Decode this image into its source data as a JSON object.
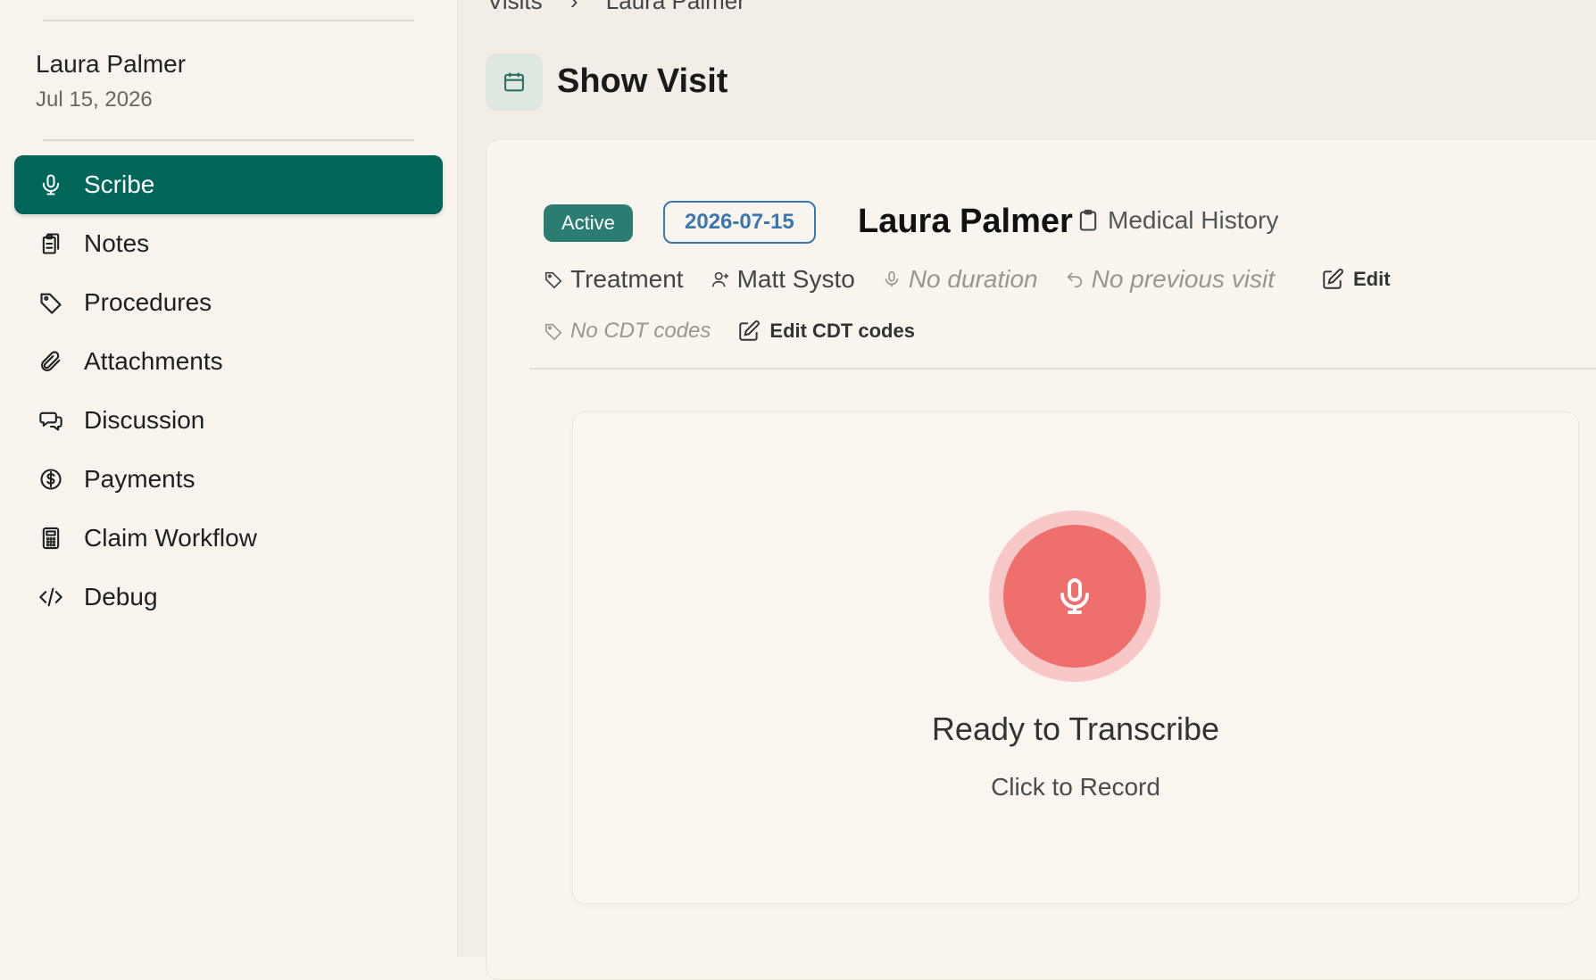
{
  "breadcrumb": {
    "root": "Visits",
    "sep": "›",
    "current": "Laura Palmer"
  },
  "sidebar": {
    "patient_name": "Laura Palmer",
    "patient_date": "Jul 15, 2026",
    "items": [
      {
        "label": "Scribe",
        "icon": "microphone-icon",
        "active": true
      },
      {
        "label": "Notes",
        "icon": "clipboard-copy-icon"
      },
      {
        "label": "Procedures",
        "icon": "tag-icon"
      },
      {
        "label": "Attachments",
        "icon": "paperclip-icon"
      },
      {
        "label": "Discussion",
        "icon": "chat-bubbles-icon"
      },
      {
        "label": "Payments",
        "icon": "dollar-circle-icon"
      },
      {
        "label": "Claim Workflow",
        "icon": "calculator-icon"
      },
      {
        "label": "Debug",
        "icon": "code-icon"
      }
    ]
  },
  "header": {
    "title": "Show Visit",
    "icon": "calendar-icon"
  },
  "visit": {
    "status": "Active",
    "date": "2026-07-15",
    "patient_name": "Laura Palmer",
    "medical_history": "Medical History",
    "type": "Treatment",
    "provider": "Matt Systo",
    "duration": "No duration",
    "previous_visit": "No previous visit",
    "edit_label": "Edit",
    "cdt_codes": "No CDT codes",
    "edit_cdt_label": "Edit CDT codes"
  },
  "recorder": {
    "title": "Ready to Transcribe",
    "subtitle": "Click to Record"
  },
  "colors": {
    "accent": "#00665a",
    "status_badge": "#2b7d72",
    "date_chip": "#3a77b0",
    "record_button": "#ef6f6d",
    "record_ring": "#f7c8c7"
  }
}
